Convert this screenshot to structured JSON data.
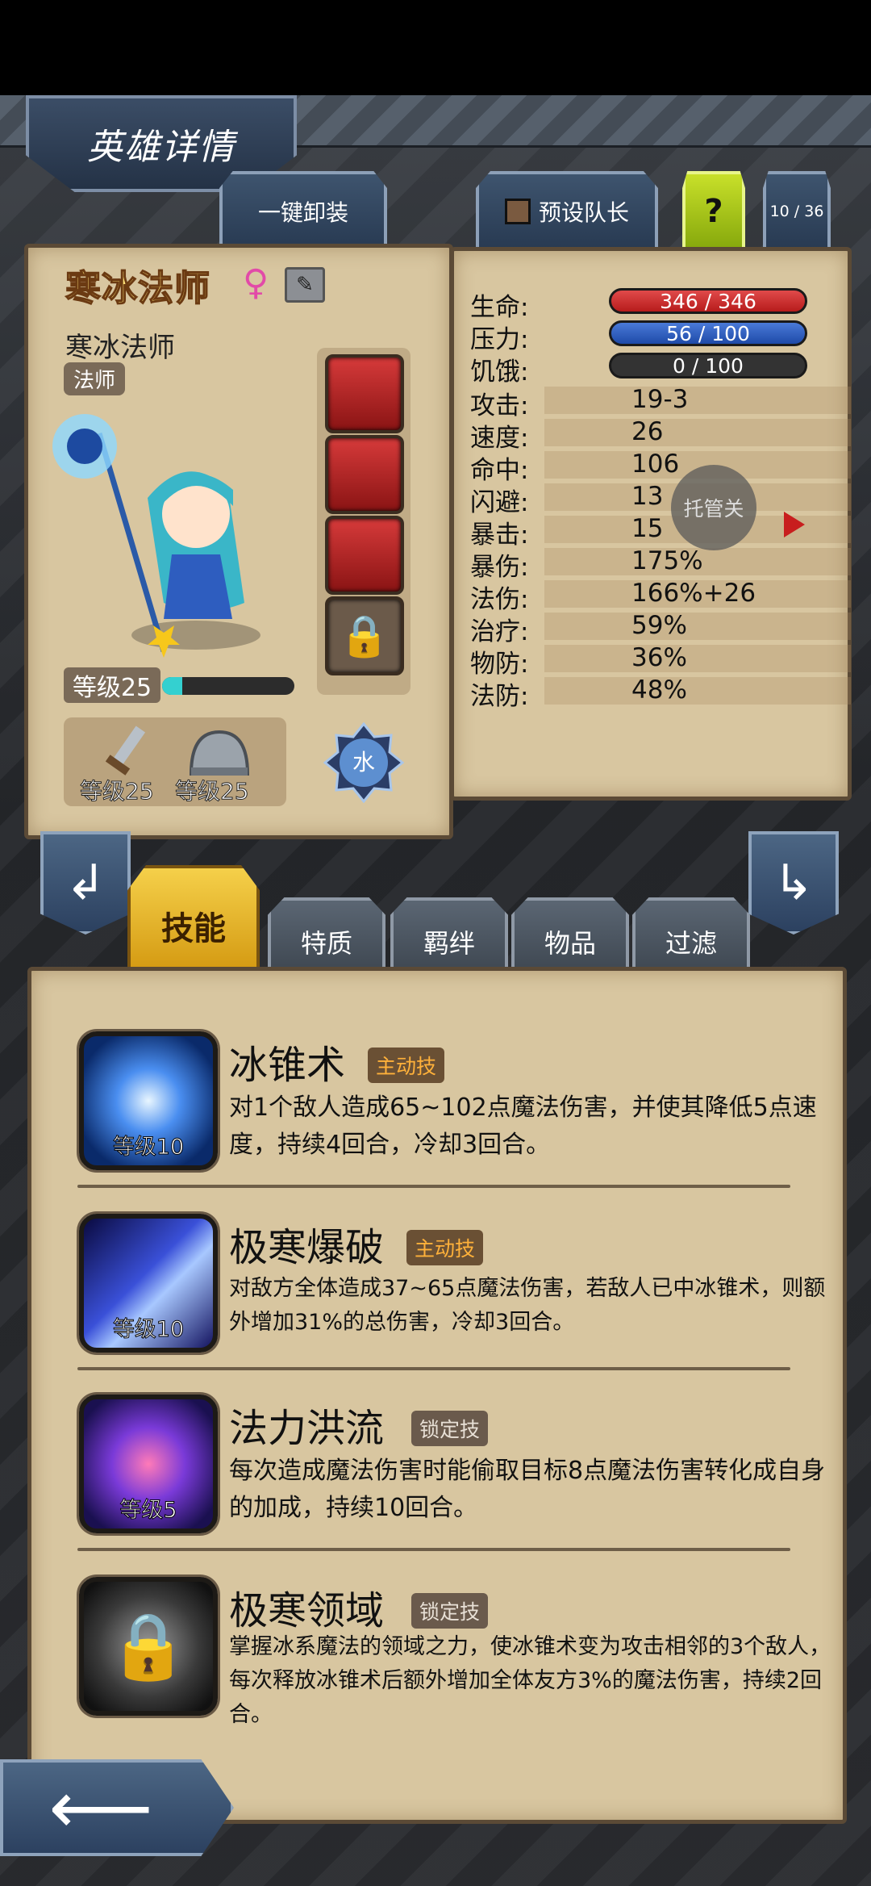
{
  "header": {
    "title": "英雄详情"
  },
  "top_buttons": {
    "unequip_all": "一键卸装",
    "preset_leader": "预设队长",
    "help": "?",
    "page_counter": "10 / 36"
  },
  "hero": {
    "name": "寒冰法师",
    "subtitle": "寒冰法师",
    "class": "法师",
    "level_label": "等级25",
    "exp_progress": 0.15,
    "element": "水",
    "weapon_level": "等级25",
    "armor_level": "等级25"
  },
  "stats": {
    "hp": {
      "label": "生命:",
      "value": "346 / 346"
    },
    "stress": {
      "label": "压力:",
      "value": "56 / 100"
    },
    "hunger": {
      "label": "饥饿:",
      "value": "0 / 100"
    },
    "rows": [
      {
        "label": "攻击:",
        "value": "19-3"
      },
      {
        "label": "速度:",
        "value": "26"
      },
      {
        "label": "命中:",
        "value": "106"
      },
      {
        "label": "闪避:",
        "value": "13"
      },
      {
        "label": "暴击:",
        "value": "15"
      },
      {
        "label": "暴伤:",
        "value": "175%"
      },
      {
        "label": "法伤:",
        "value": "166%+26"
      },
      {
        "label": "治疗:",
        "value": "59%"
      },
      {
        "label": "物防:",
        "value": "36%"
      },
      {
        "label": "法防:",
        "value": "48%"
      }
    ]
  },
  "overlay": {
    "tuoguan": "托管关"
  },
  "tabs": [
    "技能",
    "特质",
    "羁绊",
    "物品",
    "过滤"
  ],
  "skills": [
    {
      "name": "冰锥术",
      "tag": "主动技",
      "level": "等级10",
      "desc": "对1个敌人造成65~102点魔法伤害，并使其降低5点速度，持续4回合，冷却3回合。"
    },
    {
      "name": "极寒爆破",
      "tag": "主动技",
      "level": "等级10",
      "desc": "对敌方全体造成37~65点魔法伤害，若敌人已中冰锥术，则额外增加31%的总伤害，冷却3回合。"
    },
    {
      "name": "法力洪流",
      "tag": "锁定技",
      "level": "等级5",
      "desc": "每次造成魔法伤害时能偷取目标8点魔法伤害转化成自身的加成，持续10回合。"
    },
    {
      "name": "极寒领域",
      "tag": "锁定技",
      "level": "",
      "desc": "掌握冰系魔法的领域之力，使冰锥术变为攻击相邻的3个敌人，每次释放冰锥术后额外增加全体友方3%的魔法伤害，持续2回合。"
    }
  ],
  "colors": {
    "gold": "#f5d04a",
    "parchment": "#d8c6a0",
    "hp": "#d32f2f",
    "stress": "#2f5fc8"
  }
}
